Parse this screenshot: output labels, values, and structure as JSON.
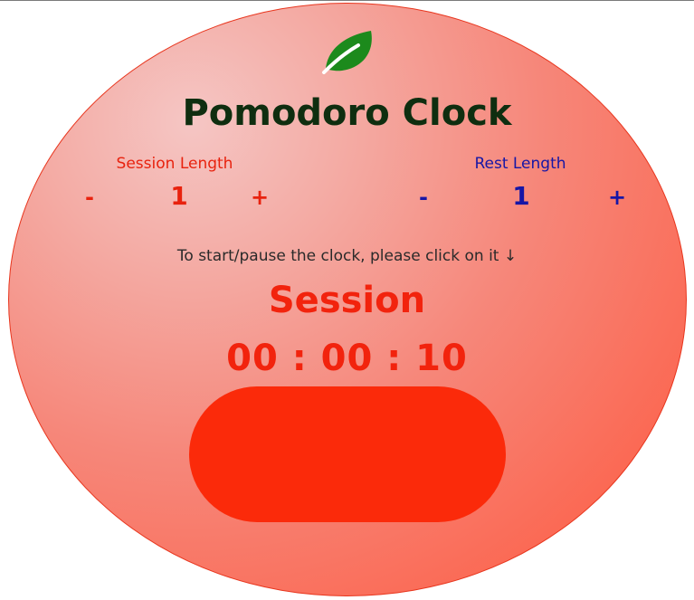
{
  "app": {
    "title": "Pomodoro Clock"
  },
  "session": {
    "label": "Session Length",
    "decrement": "-",
    "value": "1",
    "increment": "+"
  },
  "rest": {
    "label": "Rest Length",
    "decrement": "-",
    "value": "1",
    "increment": "+"
  },
  "clock": {
    "hint": "To start/pause the clock, please click on it ↓",
    "phase": "Session",
    "time": "00 : 00 : 10"
  },
  "colors": {
    "title": "#0f2e10",
    "session_accent": "#e8220e",
    "rest_accent": "#1616a6",
    "clock_button": "#fb2a0a",
    "leaf": "#1c8a1c"
  },
  "icons": {
    "logo": "leaf-icon"
  }
}
